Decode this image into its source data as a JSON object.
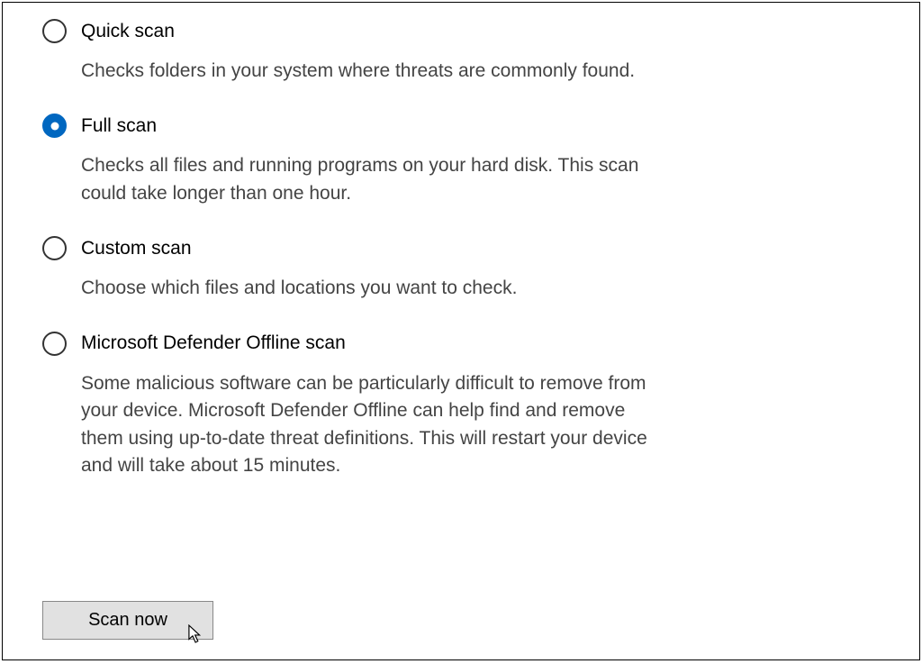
{
  "options": [
    {
      "id": "quick",
      "title": "Quick scan",
      "description": "Checks folders in your system where threats are commonly found.",
      "selected": false
    },
    {
      "id": "full",
      "title": "Full scan",
      "description": "Checks all files and running programs on your hard disk. This scan could take longer than one hour.",
      "selected": true
    },
    {
      "id": "custom",
      "title": "Custom scan",
      "description": "Choose which files and locations you want to check.",
      "selected": false
    },
    {
      "id": "offline",
      "title": "Microsoft Defender Offline scan",
      "description": "Some malicious software can be particularly difficult to remove from your device. Microsoft Defender Offline can help find and remove them using up-to-date threat definitions. This will restart your device and will take about 15 minutes.",
      "selected": false
    }
  ],
  "button": {
    "scan_now": "Scan now"
  }
}
